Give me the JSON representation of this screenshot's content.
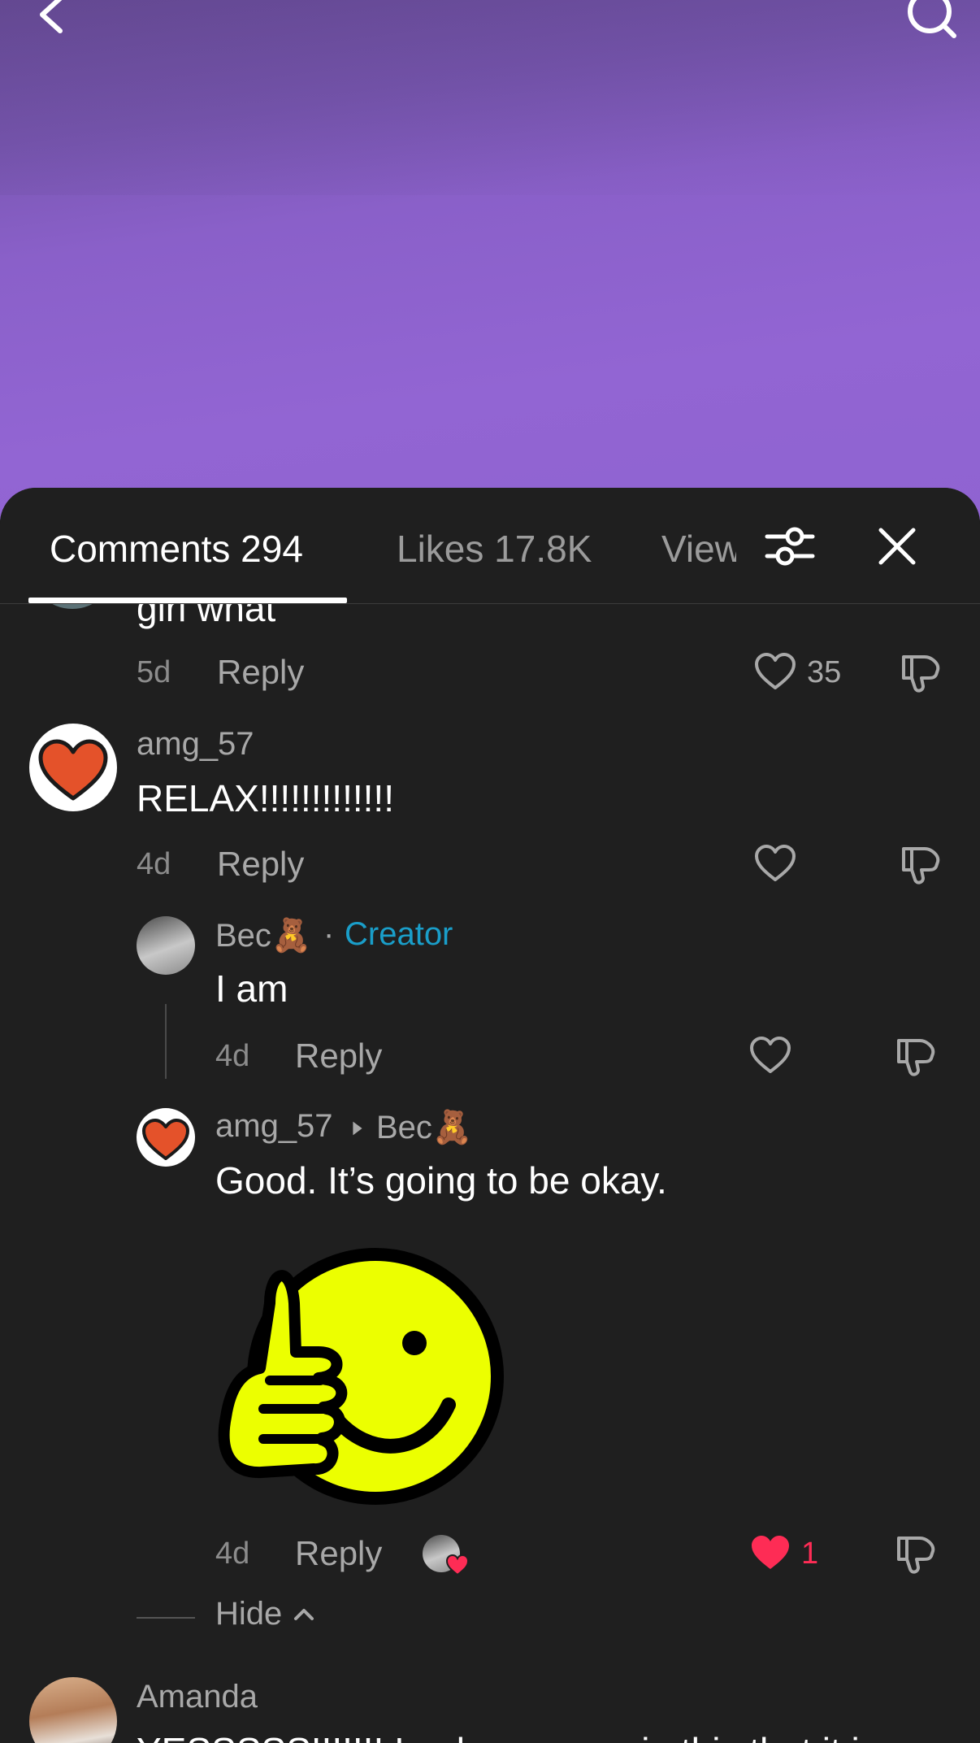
{
  "header": {
    "back_icon": "chevron-left-icon",
    "search_icon": "search-icon"
  },
  "tabs": [
    {
      "label": "Comments 294",
      "active": true
    },
    {
      "label": "Likes 17.8K",
      "active": false
    },
    {
      "label": "Views",
      "active": false
    }
  ],
  "toolbar": {
    "filter_icon": "sliders-icon",
    "close_icon": "close-icon"
  },
  "comments": [
    {
      "text": "girl what",
      "age": "5d",
      "reply_label": "Reply",
      "likes": "35"
    },
    {
      "username": "amg_57",
      "text": "RELAX!!!!!!!!!!!!!",
      "age": "4d",
      "reply_label": "Reply",
      "likes": "",
      "replies": [
        {
          "username": "Bec🧸",
          "separator": "·",
          "badge": "Creator",
          "text": "I am",
          "age": "4d",
          "reply_label": "Reply",
          "likes": ""
        },
        {
          "username": "amg_57",
          "reply_to": "Bec🧸",
          "text": "Good. It’s going to be okay.",
          "sticker": "thumbs-up-smiley-sticker",
          "age": "4d",
          "reply_label": "Reply",
          "likes": "1",
          "liked": true
        }
      ],
      "hide_label": "Hide"
    },
    {
      "username": "Amanda",
      "text": "YESSSSS!!!!!!! I only saw you in this that it is"
    }
  ],
  "colors": {
    "accent_creator": "#1a9ec9",
    "like_red": "#fe2c55",
    "sheet_bg": "#1f1f1f",
    "video_purple": "#9265d3"
  }
}
